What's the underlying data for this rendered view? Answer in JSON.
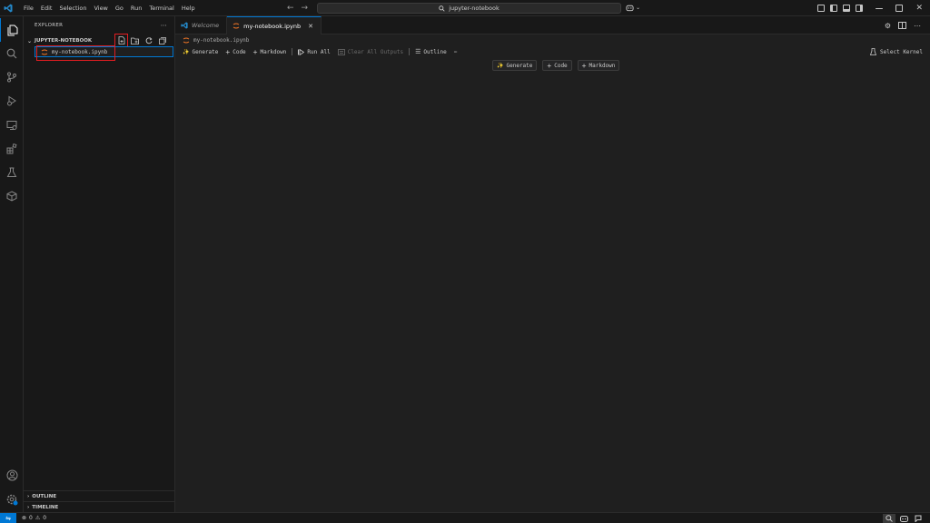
{
  "menu": [
    "File",
    "Edit",
    "Selection",
    "View",
    "Go",
    "Run",
    "Terminal",
    "Help"
  ],
  "search": {
    "text": "jupyter-notebook"
  },
  "sidebar": {
    "title": "EXPLORER",
    "folder": "JUPYTER-NOTEBOOK",
    "file": "my-notebook.ipynb",
    "sections": {
      "outline": "OUTLINE",
      "timeline": "TIMELINE"
    }
  },
  "tabs": [
    {
      "label": "Welcome"
    },
    {
      "label": "my-notebook.ipynb"
    }
  ],
  "breadcrumb": "my-notebook.ipynb",
  "toolbar": {
    "generate": "Generate",
    "code": "Code",
    "markdown": "Markdown",
    "run_all": "Run All",
    "clear_all": "Clear All Outputs",
    "outline": "Outline",
    "select_kernel": "Select Kernel"
  },
  "cell_actions": {
    "generate": "Generate",
    "code": "Code",
    "markdown": "Markdown"
  },
  "status": {
    "errors": "0",
    "warnings": "0"
  },
  "colors": {
    "accent": "#0078d4",
    "highlight": "#e11d21",
    "background": "#1f1f1f"
  }
}
